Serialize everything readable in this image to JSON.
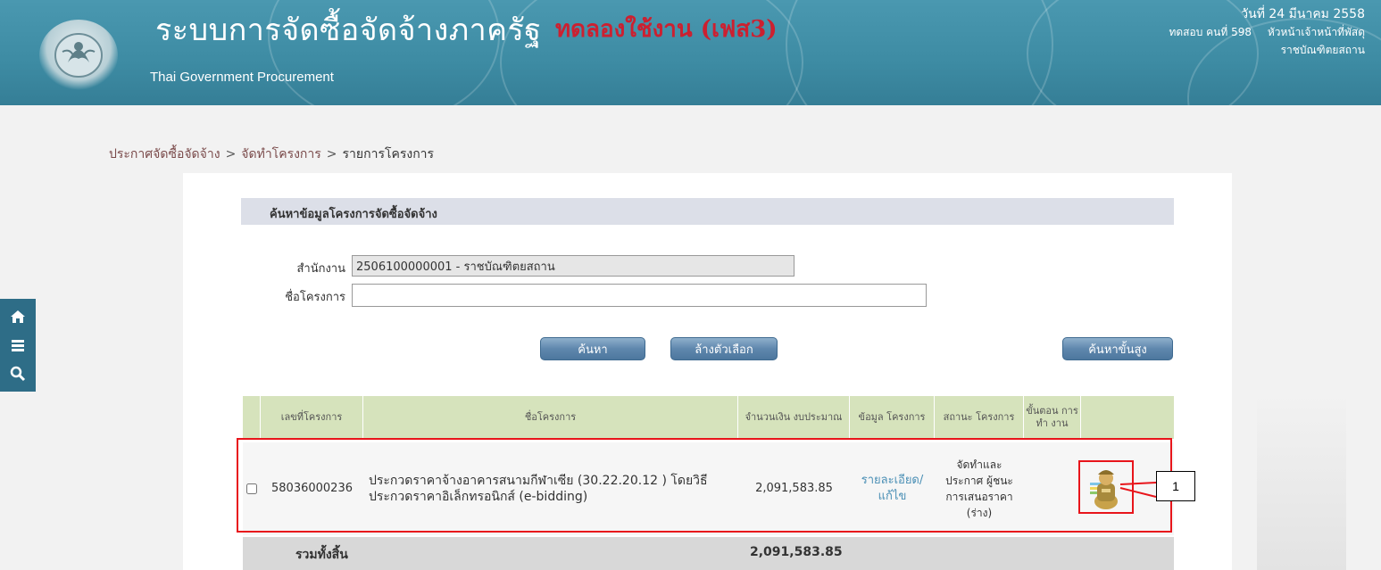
{
  "header": {
    "title_th": "ระบบการจัดซื้อจัดจ้างภาครัฐ",
    "title_test": "ทดลองใช้งาน (เฟส3)",
    "title_en": "Thai Government Procurement",
    "date": "วันที่ 24 มีนาคม 2558",
    "user_code": "ทดสอบ คนที่ 598",
    "user_role": "หัวหน้าเจ้าหน้าที่พัสดุ",
    "agency": "ราชบัณฑิตยสถาน"
  },
  "breadcrumb": {
    "item1": "ประกาศจัดซื้อจัดจ้าง",
    "sep": ">",
    "item2": "จัดทำโครงการ",
    "item3": "รายการโครงการ"
  },
  "search": {
    "panel_title": "ค้นหาข้อมูลโครงการจัดซื้อจัดจ้าง",
    "agency_label": "สำนักงาน",
    "agency_value": "2506100000001 - ราชบัณฑิตยสถาน",
    "project_label": "ชื่อโครงการ",
    "project_value": "",
    "btn_search": "ค้นหา",
    "btn_clear": "ล้างตัวเลือก",
    "btn_more": "ค้นหาขั้นสูง"
  },
  "table": {
    "headers": {
      "project_no": "เลขที่โครงการ",
      "project_name": "ชื่อโครงการ",
      "budget": "จำนวนเงิน งบประมาณ",
      "project_info": "ข้อมูล โครงการ",
      "status": "สถานะ โครงการ",
      "step": "ขั้นตอน การทำ งาน"
    },
    "rows": [
      {
        "project_no": "58036000236",
        "project_name": "ประกวดราคาจ้างอาคารสนามกีฬาเซีย (30.22.20.12 ) โดยวิธีประกวดราคาอิเล็กทรอนิกส์ (e-bidding)",
        "budget": "2,091,583.85",
        "info_link": "รายละเอียด/ แก้ไข",
        "status": "จัดทำและ ประกาศ ผู้ชนะ การเสนอราคา (ร่าง)"
      }
    ],
    "total_label": "รวมทั้งสิ้น",
    "total_value": "2,091,583.85"
  },
  "annotation": {
    "callout_number": "1"
  },
  "colors": {
    "header_bg": "#3d8ba3",
    "table_header_bg": "#d6e3bc",
    "highlight": "#e8151b",
    "button": "#5f87ad"
  }
}
